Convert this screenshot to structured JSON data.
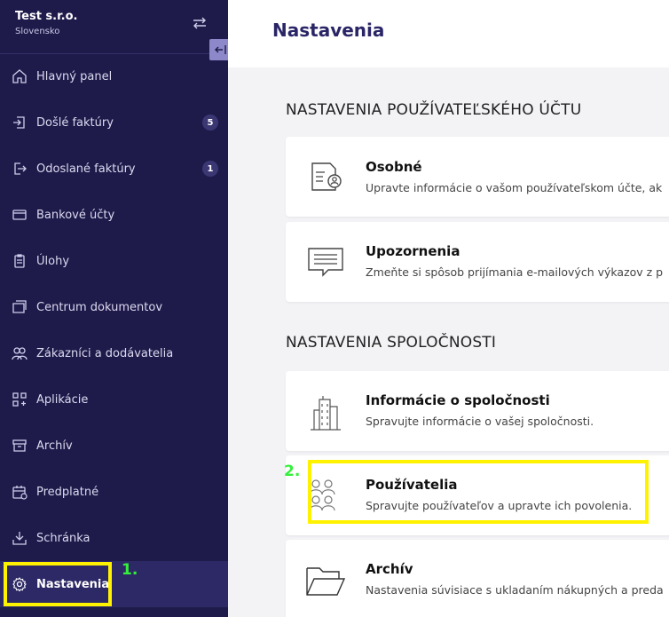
{
  "company": {
    "name": "Test s.r.o.",
    "country": "Slovensko"
  },
  "sidebar": {
    "items": [
      {
        "label": "Hlavný panel",
        "icon": "home-icon"
      },
      {
        "label": "Došlé faktúry",
        "icon": "incoming-invoice-icon",
        "badge": "5"
      },
      {
        "label": "Odoslané faktúry",
        "icon": "outgoing-invoice-icon",
        "badge": "1"
      },
      {
        "label": "Bankové účty",
        "icon": "bank-card-icon"
      },
      {
        "label": "Úlohy",
        "icon": "clipboard-icon"
      },
      {
        "label": "Centrum dokumentov",
        "icon": "documents-icon"
      },
      {
        "label": "Zákazníci a dodávatelia",
        "icon": "users-icon"
      },
      {
        "label": "Aplikácie",
        "icon": "apps-icon"
      },
      {
        "label": "Archív",
        "icon": "archive-icon"
      },
      {
        "label": "Predplatné",
        "icon": "calendar-icon"
      },
      {
        "label": "Schránka",
        "icon": "inbox-icon"
      },
      {
        "label": "Nastavenia",
        "icon": "gear-icon",
        "active": true
      }
    ]
  },
  "annotations": {
    "step1": "1.",
    "step2": "2.",
    "highlight_color": "#fff200",
    "label_color": "#35f03a"
  },
  "header": {
    "title": "Nastavenia"
  },
  "sections": {
    "account": {
      "title": "NASTAVENIA POUŽÍVATEĽSKÉHO ÚČTU",
      "cards": [
        {
          "title": "Osobné",
          "desc": "Upravte informácie o vašom používateľskom účte, ak",
          "icon": "personal-document-icon"
        },
        {
          "title": "Upozornenia",
          "desc": "Zmeňte si spôsob prijímania e-mailových výkazov z p",
          "icon": "message-icon"
        }
      ]
    },
    "company": {
      "title": "NASTAVENIA SPOLOČNOSTI",
      "cards": [
        {
          "title": "Informácie o spoločnosti",
          "desc": "Spravujte informácie o vašej spoločnosti.",
          "icon": "building-icon"
        },
        {
          "title": "Používatelia",
          "desc": "Spravujte používateľov a upravte ich povolenia.",
          "icon": "users-group-icon"
        },
        {
          "title": "Archív",
          "desc": "Nastavenia súvisiace s ukladaním nákupných a preda",
          "icon": "folder-icon"
        }
      ]
    }
  },
  "colors": {
    "sidebar_bg": "#1e1b4b",
    "title": "#2a2566"
  }
}
